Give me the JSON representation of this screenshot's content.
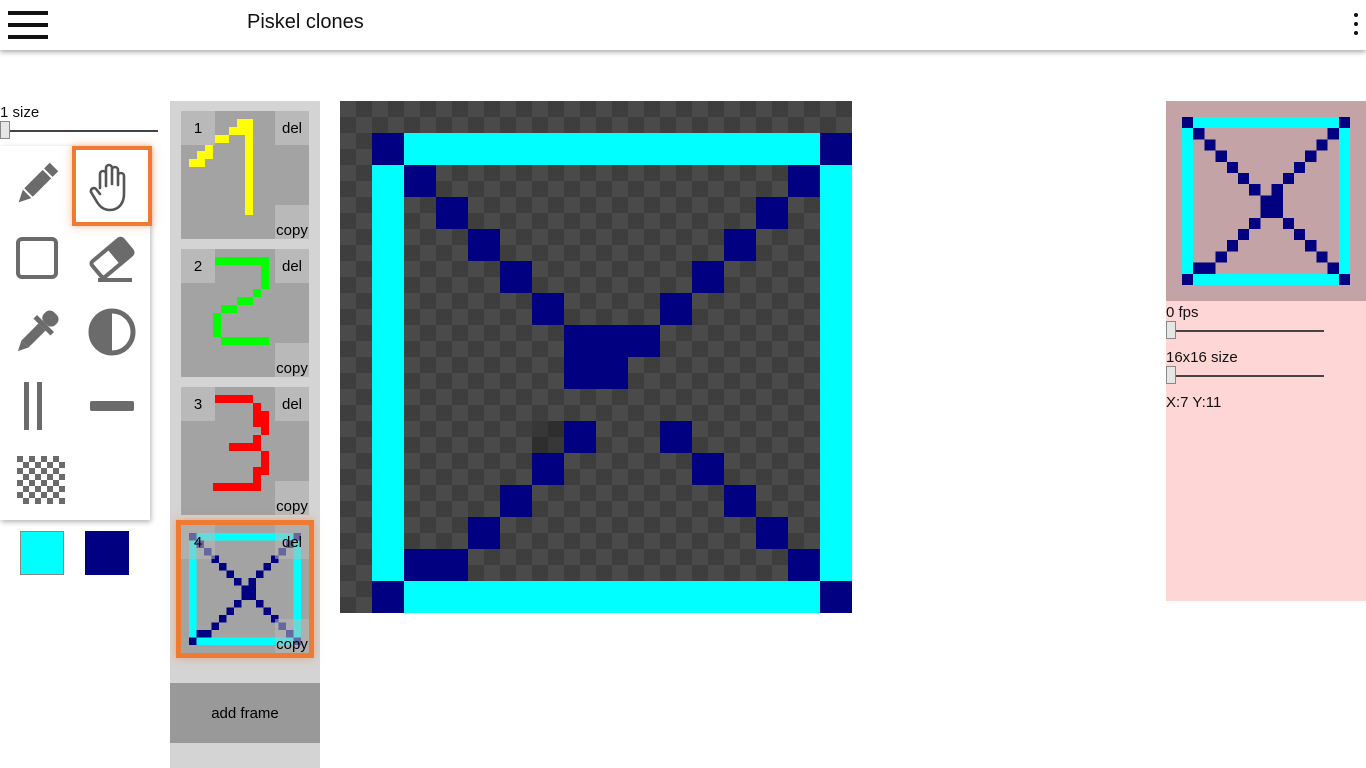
{
  "app": {
    "title": "Piskel clones"
  },
  "brush": {
    "size_label": "1 size",
    "size_value": 1
  },
  "tools": [
    {
      "name": "pencil",
      "icon": "pencil-icon",
      "selected": false
    },
    {
      "name": "move",
      "icon": "hand-icon",
      "selected": true
    },
    {
      "name": "rectangle",
      "icon": "square-outline-icon",
      "selected": false
    },
    {
      "name": "eraser",
      "icon": "eraser-icon",
      "selected": false
    },
    {
      "name": "color-picker",
      "icon": "eyedropper-icon",
      "selected": false
    },
    {
      "name": "lighten-darken",
      "icon": "contrast-icon",
      "selected": false
    },
    {
      "name": "vertical-mirror",
      "icon": "vertical-lines-icon",
      "selected": false
    },
    {
      "name": "horizontal-line",
      "icon": "horizontal-line-icon",
      "selected": false
    },
    {
      "name": "dither",
      "icon": "checkerboard-icon",
      "selected": false
    }
  ],
  "colors": {
    "primary": "#00ffff",
    "secondary": "#000080"
  },
  "frames": [
    {
      "number": "1",
      "del_label": "del",
      "copy_label": "copy",
      "color": "#ffff00"
    },
    {
      "number": "2",
      "del_label": "del",
      "copy_label": "copy",
      "color": "#00ff00"
    },
    {
      "number": "3",
      "del_label": "del",
      "copy_label": "copy",
      "color": "#ff0000"
    },
    {
      "number": "4",
      "del_label": "del",
      "copy_label": "copy",
      "selected": true
    }
  ],
  "add_frame_label": "add frame",
  "preview": {
    "fps_label": "0 fps",
    "fps_value": 0,
    "size_label": "16x16 size",
    "coords": "X:7 Y:11"
  }
}
